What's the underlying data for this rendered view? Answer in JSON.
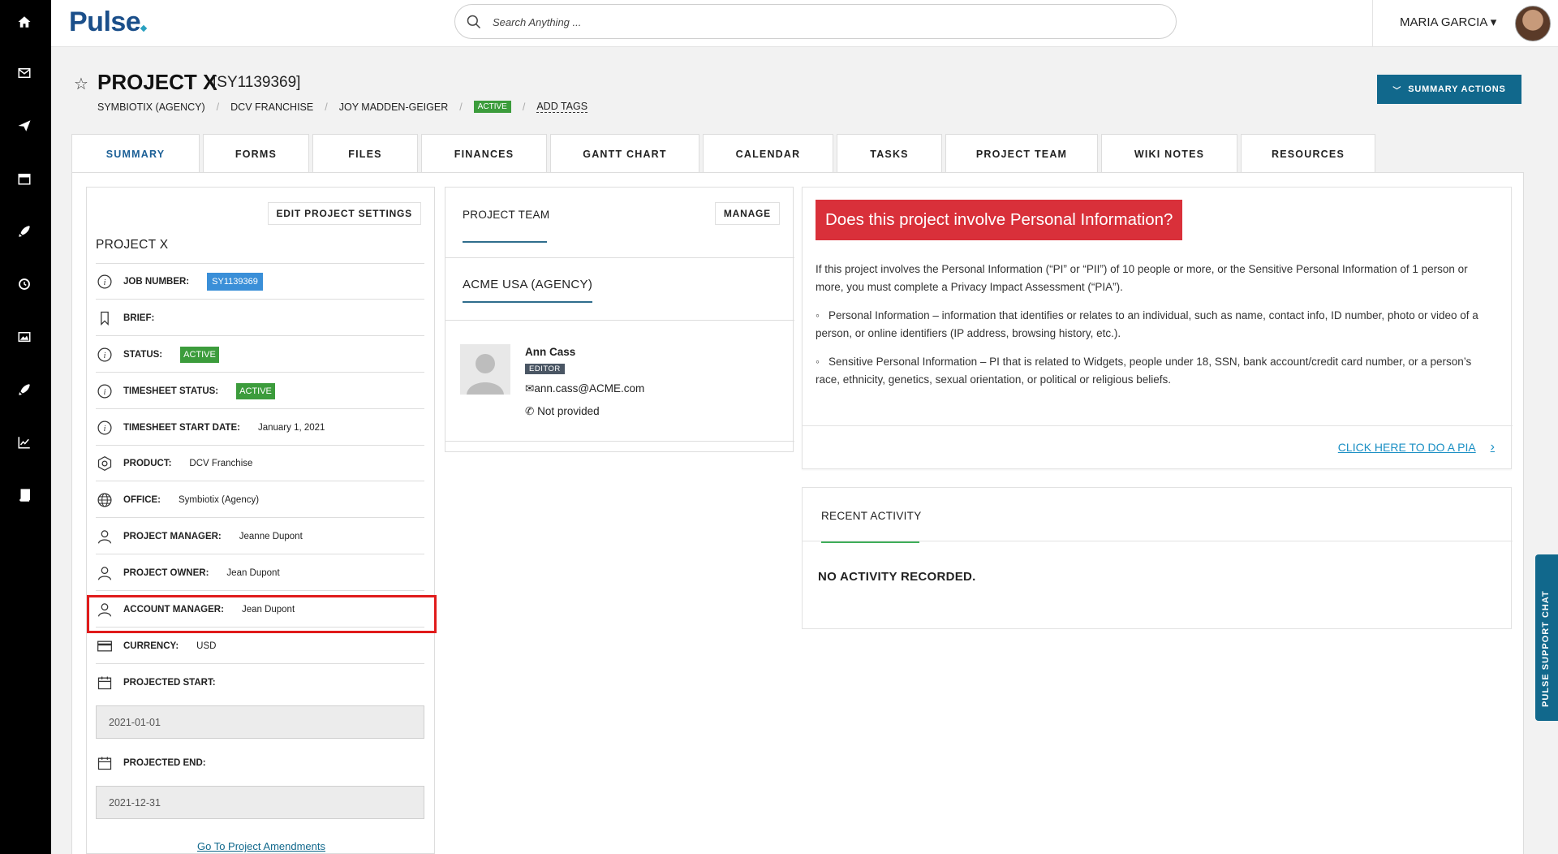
{
  "app": {
    "logo": "Pulse"
  },
  "search": {
    "placeholder": "Search Anything ..."
  },
  "user": {
    "name": "MARIA GARCIA ▾"
  },
  "sidebar": {
    "icons": [
      "home-icon",
      "mail-icon",
      "send-icon",
      "calendar-icon",
      "rocket-icon",
      "clock-icon",
      "image-icon",
      "rocket-icon",
      "chart-icon",
      "book-icon"
    ]
  },
  "project": {
    "title": "PROJECT X",
    "code": "[SY1139369]",
    "breadcrumbs": [
      "SYMBIOTIX (AGENCY)",
      "DCV FRANCHISE",
      "JOY MADDEN-GEIGER"
    ],
    "status_badge": "ACTIVE",
    "add_tags": "ADD TAGS",
    "summary_actions": "SUMMARY ACTIONS"
  },
  "tabs": [
    "SUMMARY",
    "FORMS",
    "FILES",
    "FINANCES",
    "GANTT CHART",
    "CALENDAR",
    "TASKS",
    "PROJECT TEAM",
    "WIKI NOTES",
    "RESOURCES"
  ],
  "details": {
    "edit_button": "EDIT PROJECT SETTINGS",
    "heading": "PROJECT X",
    "job_number_label": "JOB NUMBER:",
    "job_number": "SY1139369",
    "brief_label": "BRIEF:",
    "status_label": "STATUS:",
    "status": "ACTIVE",
    "timesheet_status_label": "TIMESHEET STATUS:",
    "timesheet_status": "ACTIVE",
    "timesheet_start_label": "TIMESHEET START DATE:",
    "timesheet_start": "January 1, 2021",
    "product_label": "PRODUCT:",
    "product": "DCV Franchise",
    "office_label": "OFFICE:",
    "office": "Symbiotix (Agency)",
    "pm_label": "PROJECT MANAGER:",
    "pm": "Jeanne Dupont",
    "owner_label": "PROJECT OWNER:",
    "owner": "Jean Dupont",
    "am_label": "ACCOUNT MANAGER:",
    "am": "Jean Dupont",
    "currency_label": "CURRENCY:",
    "currency": "USD",
    "proj_start_label": "PROJECTED START:",
    "proj_start": "2021-01-01",
    "proj_end_label": "PROJECTED END:",
    "proj_end": "2021-12-31",
    "amendments_link": "Go To Project Amendments"
  },
  "team": {
    "title": "PROJECT TEAM",
    "manage": "MANAGE",
    "agency": "ACME USA (AGENCY)",
    "member": {
      "name": "Ann Cass",
      "role": "EDITOR",
      "email": "ann.cass@ACME.com",
      "phone": "Not provided"
    }
  },
  "pii": {
    "banner": "Does this project involve Personal Information?",
    "intro": "If this project involves the Personal Information (“PI” or “PII”) of 10 people or more, or the Sensitive Personal Information of 1 person or more, you must complete a Privacy Impact Assessment (“PIA”).",
    "bullet1": "Personal Information – information that identifies or relates to an individual, such as name, contact info, ID number, photo or video of a person, or online identifiers (IP address, browsing history, etc.).",
    "bullet2": "Sensitive Personal Information – PI that is related to Widgets, people under 18, SSN, bank account/credit card number, or a person’s race, ethnicity, genetics, sexual orientation, or political or religious beliefs.",
    "link": "CLICK HERE TO DO A PIA"
  },
  "activity": {
    "title": "RECENT ACTIVITY",
    "empty": "NO ACTIVITY RECORDED."
  },
  "support_chat": "PULSE SUPPORT CHAT",
  "colors": {
    "accent": "#11688c",
    "active_green": "#3c9c3c",
    "alert_red": "#d9303a",
    "highlight_red": "#e01b1b"
  }
}
